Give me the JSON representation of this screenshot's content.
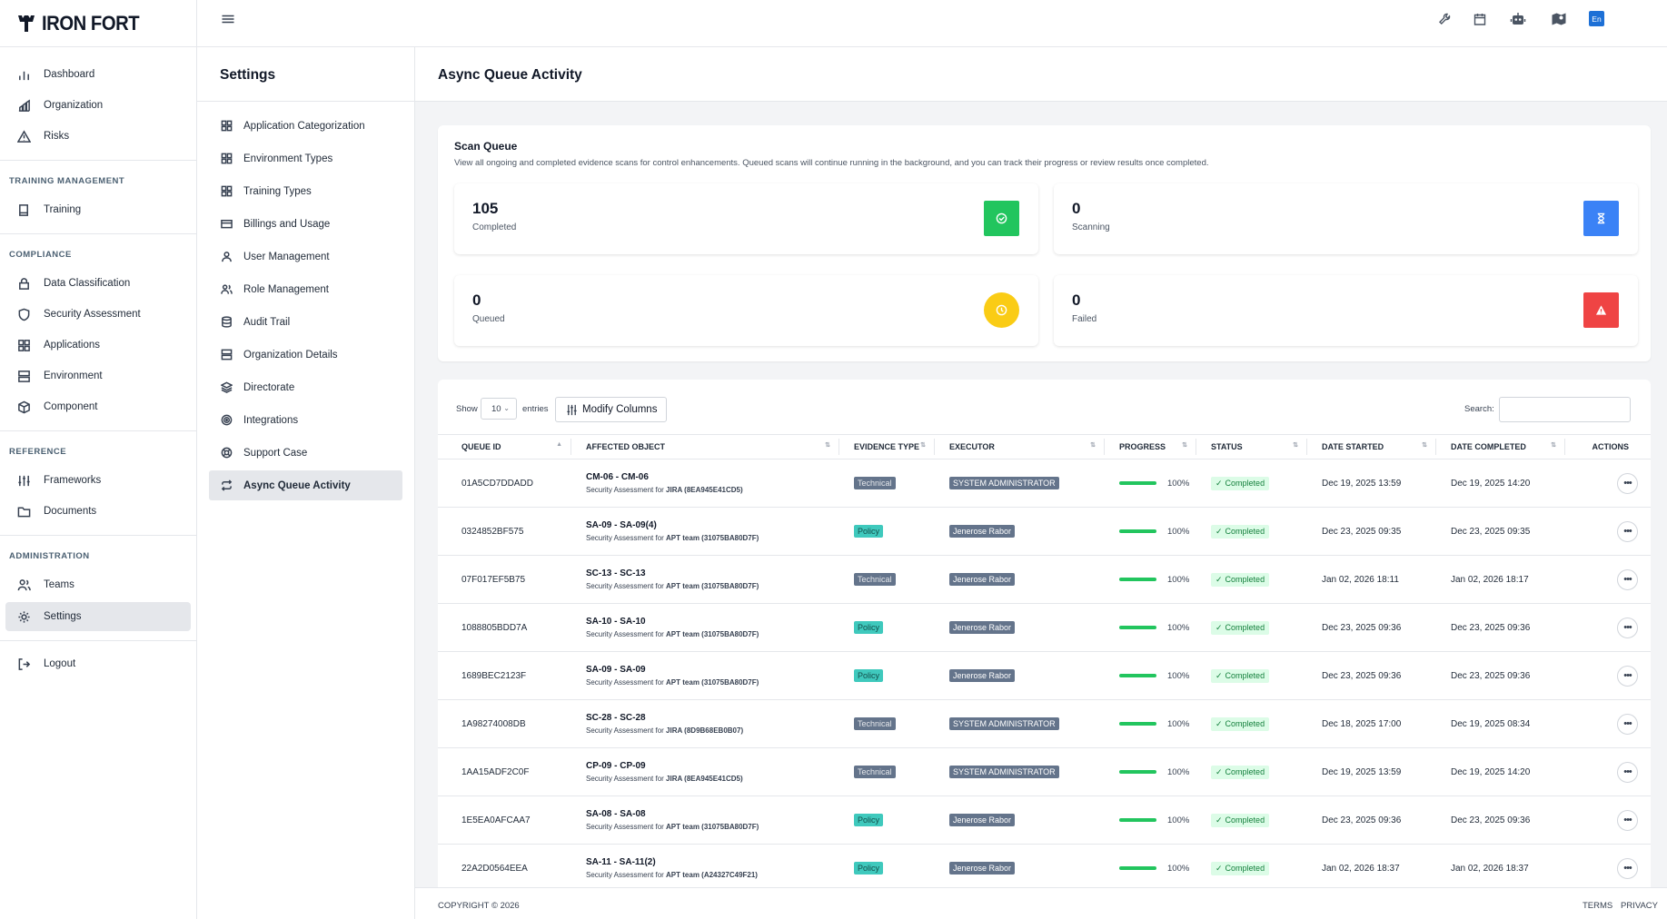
{
  "brand": {
    "name": "IRON FORT"
  },
  "sidebar": {
    "items_top": [
      {
        "label": "Dashboard",
        "icon": "bar-chart-icon"
      },
      {
        "label": "Organization",
        "icon": "building-chart-icon"
      },
      {
        "label": "Risks",
        "icon": "warning-triangle-icon"
      }
    ],
    "section_training": "TRAINING MANAGEMENT",
    "items_training": [
      {
        "label": "Training",
        "icon": "book-icon"
      }
    ],
    "section_compliance": "COMPLIANCE",
    "items_compliance": [
      {
        "label": "Data Classification",
        "icon": "lock-icon"
      },
      {
        "label": "Security Assessment",
        "icon": "shield-icon"
      },
      {
        "label": "Applications",
        "icon": "grid-icon"
      },
      {
        "label": "Environment",
        "icon": "server-icon"
      },
      {
        "label": "Component",
        "icon": "cube-icon"
      }
    ],
    "section_reference": "REFERENCE",
    "items_reference": [
      {
        "label": "Frameworks",
        "icon": "sliders-icon"
      },
      {
        "label": "Documents",
        "icon": "folder-icon"
      }
    ],
    "section_admin": "ADMINISTRATION",
    "items_admin": [
      {
        "label": "Teams",
        "icon": "users-icon"
      },
      {
        "label": "Settings",
        "icon": "gear-icon"
      }
    ],
    "logout": "Logout"
  },
  "topbar": {
    "lang": "En"
  },
  "settings": {
    "title": "Settings",
    "items": [
      {
        "label": "Application Categorization",
        "icon": "grid-icon"
      },
      {
        "label": "Environment Types",
        "icon": "grid-icon"
      },
      {
        "label": "Training Types",
        "icon": "grid-icon"
      },
      {
        "label": "Billings and Usage",
        "icon": "credit-card-icon"
      },
      {
        "label": "User Management",
        "icon": "user-icon"
      },
      {
        "label": "Role Management",
        "icon": "users-icon"
      },
      {
        "label": "Audit Trail",
        "icon": "database-icon"
      },
      {
        "label": "Organization Details",
        "icon": "server-icon"
      },
      {
        "label": "Directorate",
        "icon": "layers-icon"
      },
      {
        "label": "Integrations",
        "icon": "target-icon"
      },
      {
        "label": "Support Case",
        "icon": "lifebuoy-icon"
      },
      {
        "label": "Async Queue Activity",
        "icon": "repeat-icon"
      }
    ]
  },
  "page": {
    "title": "Async Queue Activity"
  },
  "scan_queue": {
    "title": "Scan Queue",
    "description": "View all ongoing and completed evidence scans for control enhancements. Queued scans will continue running in the background, and you can track their progress or review results once completed.",
    "stats": [
      {
        "value": "105",
        "label": "Completed",
        "color": "#22c55e"
      },
      {
        "value": "0",
        "label": "Scanning",
        "color": "#3b82f6"
      },
      {
        "value": "0",
        "label": "Queued",
        "color": "#facc15"
      },
      {
        "value": "0",
        "label": "Failed",
        "color": "#ef4444"
      }
    ]
  },
  "table_controls": {
    "show": "Show",
    "entries_value": "10",
    "entries": "entries",
    "modify_columns": "Modify Columns",
    "search_label": "Search:",
    "search_value": ""
  },
  "columns": [
    "QUEUE ID",
    "AFFECTED OBJECT",
    "EVIDENCE TYPE",
    "EXECUTOR",
    "PROGRESS",
    "STATUS",
    "DATE STARTED",
    "DATE COMPLETED",
    "ACTIONS"
  ],
  "rows": [
    {
      "id": "01A5CD7DDADD",
      "obj": "CM-06 - CM-06",
      "sub_prefix": "Security Assessment for ",
      "sub_bold": "JIRA (8EA945E41CD5)",
      "type": "Technical",
      "executor": "SYSTEM ADMINISTRATOR",
      "progress": "100%",
      "progress_value": 100,
      "status": "Completed",
      "started": "Dec 19, 2025 13:59",
      "completed": "Dec 19, 2025 14:20"
    },
    {
      "id": "0324852BF575",
      "obj": "SA-09 - SA-09(4)",
      "sub_prefix": "Security Assessment for ",
      "sub_bold": "APT team (31075BA80D7F)",
      "type": "Policy",
      "executor": "Jenerose Rabor",
      "progress": "100%",
      "progress_value": 100,
      "status": "Completed",
      "started": "Dec 23, 2025 09:35",
      "completed": "Dec 23, 2025 09:35"
    },
    {
      "id": "07F017EF5B75",
      "obj": "SC-13 - SC-13",
      "sub_prefix": "Security Assessment for ",
      "sub_bold": "APT team (31075BA80D7F)",
      "type": "Technical",
      "executor": "Jenerose Rabor",
      "progress": "100%",
      "progress_value": 100,
      "status": "Completed",
      "started": "Jan 02, 2026 18:11",
      "completed": "Jan 02, 2026 18:17"
    },
    {
      "id": "1088805BDD7A",
      "obj": "SA-10 - SA-10",
      "sub_prefix": "Security Assessment for ",
      "sub_bold": "APT team (31075BA80D7F)",
      "type": "Policy",
      "executor": "Jenerose Rabor",
      "progress": "100%",
      "progress_value": 100,
      "status": "Completed",
      "started": "Dec 23, 2025 09:36",
      "completed": "Dec 23, 2025 09:36"
    },
    {
      "id": "1689BEC2123F",
      "obj": "SA-09 - SA-09",
      "sub_prefix": "Security Assessment for ",
      "sub_bold": "APT team (31075BA80D7F)",
      "type": "Policy",
      "executor": "Jenerose Rabor",
      "progress": "100%",
      "progress_value": 100,
      "status": "Completed",
      "started": "Dec 23, 2025 09:36",
      "completed": "Dec 23, 2025 09:36"
    },
    {
      "id": "1A98274008DB",
      "obj": "SC-28 - SC-28",
      "sub_prefix": "Security Assessment for ",
      "sub_bold": "JIRA (8D9B68EB0B07)",
      "type": "Technical",
      "executor": "SYSTEM ADMINISTRATOR",
      "progress": "100%",
      "progress_value": 100,
      "status": "Completed",
      "started": "Dec 18, 2025 17:00",
      "completed": "Dec 19, 2025 08:34"
    },
    {
      "id": "1AA15ADF2C0F",
      "obj": "CP-09 - CP-09",
      "sub_prefix": "Security Assessment for ",
      "sub_bold": "JIRA (8EA945E41CD5)",
      "type": "Technical",
      "executor": "SYSTEM ADMINISTRATOR",
      "progress": "100%",
      "progress_value": 100,
      "status": "Completed",
      "started": "Dec 19, 2025 13:59",
      "completed": "Dec 19, 2025 14:20"
    },
    {
      "id": "1E5EA0AFCAA7",
      "obj": "SA-08 - SA-08",
      "sub_prefix": "Security Assessment for ",
      "sub_bold": "APT team (31075BA80D7F)",
      "type": "Policy",
      "executor": "Jenerose Rabor",
      "progress": "100%",
      "progress_value": 100,
      "status": "Completed",
      "started": "Dec 23, 2025 09:36",
      "completed": "Dec 23, 2025 09:36"
    },
    {
      "id": "22A2D0564EEA",
      "obj": "SA-11 - SA-11(2)",
      "sub_prefix": "Security Assessment for ",
      "sub_bold": "APT team (A24327C49F21)",
      "type": "Policy",
      "executor": "Jenerose Rabor",
      "progress": "100%",
      "progress_value": 100,
      "status": "Completed",
      "started": "Jan 02, 2026 18:37",
      "completed": "Jan 02, 2026 18:37"
    }
  ],
  "footer": {
    "copyright": "COPYRIGHT © 2026",
    "terms": "TERMS",
    "privacy": "PRIVACY"
  }
}
